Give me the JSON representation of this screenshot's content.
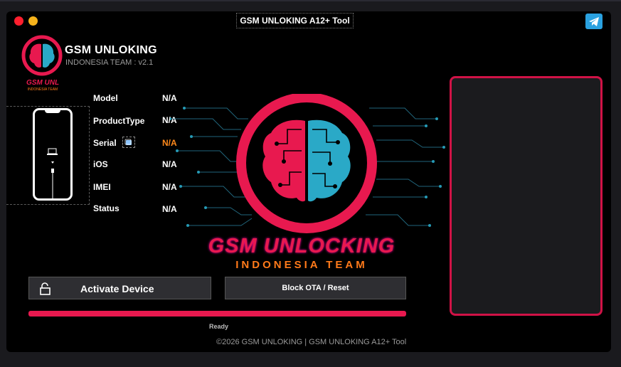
{
  "window": {
    "title": "GSM UNLOKING A12+ Tool"
  },
  "brand": {
    "name": "GSM UNLOKING",
    "subtitle": "INDONESIA TEAM : v2.1"
  },
  "device_info": [
    {
      "label": "Model",
      "value": "N/A"
    },
    {
      "label": "ProductType",
      "value": "N/A"
    },
    {
      "label": "Serial",
      "value": "N/A"
    },
    {
      "label": "iOS",
      "value": "N/A"
    },
    {
      "label": "IMEI",
      "value": "N/A"
    },
    {
      "label": "Status",
      "value": "N/A"
    }
  ],
  "center_logo": {
    "title": "GSM UNLOCKING",
    "subtitle": "INDONESIA TEAM"
  },
  "buttons": {
    "activate": "Activate Device",
    "block_ota": "Block OTA / Reset"
  },
  "progress": {
    "value": 1.0,
    "status_text": "Ready"
  },
  "footer": "©2026 GSM UNLOKING  |  GSM UNLOKING A12+ Tool",
  "colors": {
    "accent": "#e8194f",
    "serial_value": "#ff8a1c",
    "telegram": "#2aa1e0",
    "brain_left": "#e8194f",
    "brain_right": "#2aa9c7"
  },
  "icons": {
    "telegram": "telegram-icon",
    "lock": "unlock-icon",
    "copy": "copy-icon",
    "phone": "iphone-icon"
  }
}
